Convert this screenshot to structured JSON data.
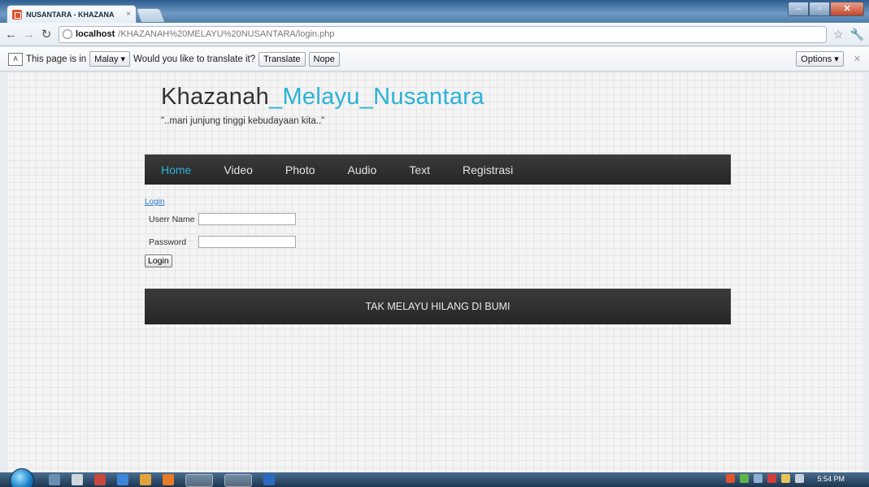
{
  "browser": {
    "tab_title": "NUSANTARA - KHAZANA",
    "tab_close": "×",
    "url_host": "localhost",
    "url_path": "/KHAZANAH%20MELAYU%20NUSANTARA/login.php",
    "window_min": "–",
    "window_max": "▫",
    "window_close": "✕"
  },
  "translate_bar": {
    "prefix": "This page is in",
    "language": "Malay ▾",
    "question": "Would you like to translate it?",
    "translate_label": "Translate",
    "nope_label": "Nope",
    "options_label": "Options ▾",
    "close": "✕"
  },
  "site": {
    "title_plain": "Khazanah",
    "title_highlight": "_Melayu_Nusantara",
    "tagline": "\"..mari junjung tinggi kebudayaan kita..\"",
    "accent_color": "#2ab3d8"
  },
  "nav": {
    "items": [
      {
        "label": "Home",
        "active": true
      },
      {
        "label": "Video"
      },
      {
        "label": "Photo"
      },
      {
        "label": "Audio"
      },
      {
        "label": "Text"
      },
      {
        "label": "Registrasi"
      }
    ]
  },
  "login": {
    "heading_link": "Login",
    "username_label": "Userr Name",
    "password_label": "Password",
    "username_value": "",
    "password_value": "",
    "submit_label": "Login"
  },
  "footer": {
    "text": "TAK MELAYU HILANG DI BUMI"
  },
  "taskbar": {
    "clock": "5:54 PM"
  }
}
